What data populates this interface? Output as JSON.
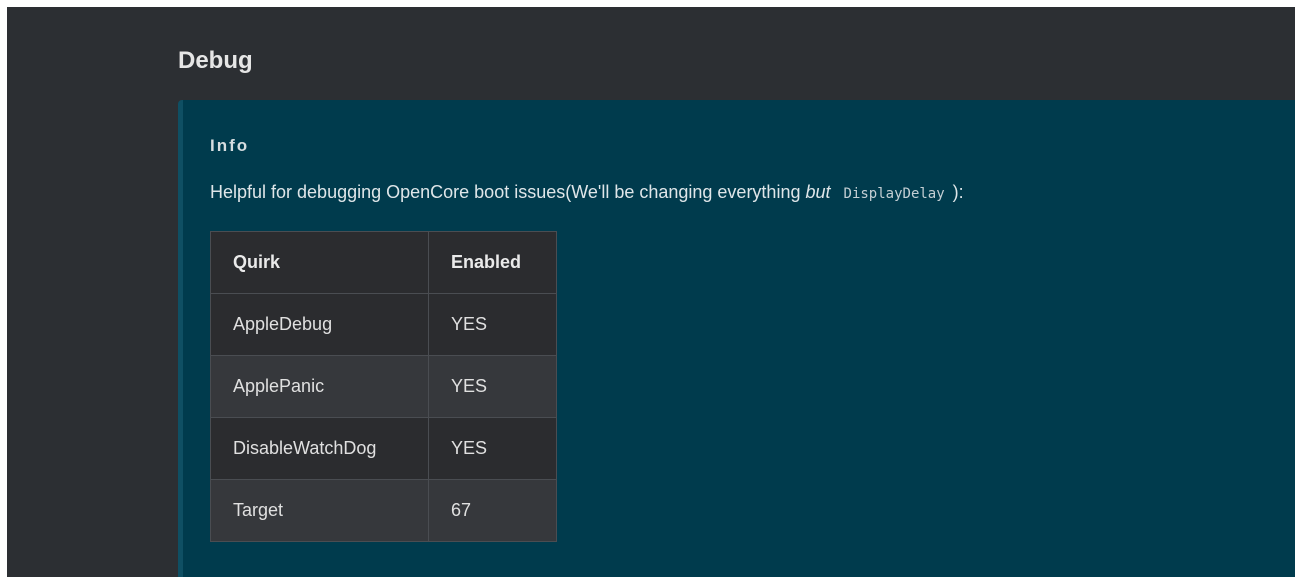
{
  "page": {
    "title": "Debug"
  },
  "info": {
    "title": "Info",
    "text_before": "Helpful for debugging OpenCore boot issues(We'll be changing everything ",
    "text_emphasis": "but",
    "text_code": "DisplayDelay",
    "text_after": "):"
  },
  "table": {
    "headers": [
      "Quirk",
      "Enabled"
    ],
    "rows": [
      {
        "quirk": "AppleDebug",
        "enabled": "YES"
      },
      {
        "quirk": "ApplePanic",
        "enabled": "YES"
      },
      {
        "quirk": "DisableWatchDog",
        "enabled": "YES"
      },
      {
        "quirk": "Target",
        "enabled": "67"
      }
    ]
  }
}
